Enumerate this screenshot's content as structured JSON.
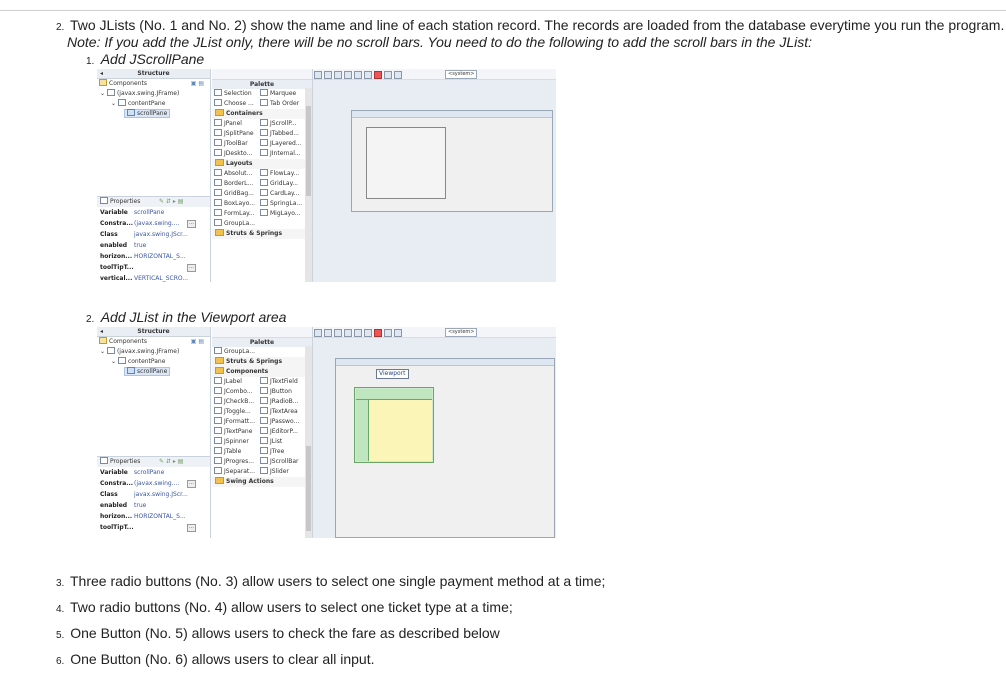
{
  "items": {
    "item2_num": "2.",
    "item2_text": "Two JLists (No. 1 and No. 2) show the name and line of each station record. The records are loaded from the database everytime you run the program.",
    "note": "Note: If you add the JList only, there will be no scroll bars. You need to do the following to add the scroll bars in the JList:",
    "sub1_num": "1.",
    "sub1_text": "Add JScrollPane",
    "sub2_num": "2.",
    "sub2_text": "Add JList in the Viewport area",
    "item3_num": "3.",
    "item3_text": "Three radio buttons (No. 3) allow users to select one single payment method at a time;",
    "item4_num": "4.",
    "item4_text": "Two radio buttons (No. 4) allow users to select one ticket type at a time;",
    "item5_num": "5.",
    "item5_text": "One Button (No. 5) allows users to check the fare as described below",
    "item6_num": "6.",
    "item6_text": "One Button (No. 6) allows users to clear all input."
  },
  "ide": {
    "structure": "Structure",
    "components": "Components",
    "frame": "(javax.swing.JFrame)",
    "content_pane": "contentPane",
    "scroll_pane": "scrollPane",
    "palette": "Palette",
    "system": "<system>",
    "viewport": "Viewport",
    "properties": "Properties",
    "props1": [
      {
        "k": "Variable",
        "v": "scrollPane"
      },
      {
        "k": "Constra...",
        "v": "(javax.swing...."
      },
      {
        "k": "Class",
        "v": "javax.swing.JScr..."
      },
      {
        "k": "enabled",
        "v": "true"
      },
      {
        "k": "horizon...",
        "v": "HORIZONTAL_S..."
      },
      {
        "k": "toolTipT...",
        "v": ""
      },
      {
        "k": "vertical...",
        "v": "VERTICAL_SCRO..."
      }
    ],
    "props2": [
      {
        "k": "Variable",
        "v": "scrollPane"
      },
      {
        "k": "Constra...",
        "v": "(javax.swing...."
      },
      {
        "k": "Class",
        "v": "javax.swing.JScr..."
      },
      {
        "k": "enabled",
        "v": "true"
      },
      {
        "k": "horizon...",
        "v": "HORIZONTAL_S..."
      },
      {
        "k": "toolTipT...",
        "v": ""
      }
    ],
    "palette1": [
      {
        "type": "row",
        "a": "Selection",
        "b": "Marquee"
      },
      {
        "type": "row",
        "a": "Choose ...",
        "b": "Tab Order"
      },
      {
        "type": "cat",
        "a": "Containers"
      },
      {
        "type": "row",
        "a": "JPanel",
        "b": "JScrollP..."
      },
      {
        "type": "row",
        "a": "JSplitPane",
        "b": "JTabbed..."
      },
      {
        "type": "row",
        "a": "JToolBar",
        "b": "JLayered..."
      },
      {
        "type": "row",
        "a": "JDeskto...",
        "b": "JInternal..."
      },
      {
        "type": "cat",
        "a": "Layouts"
      },
      {
        "type": "row",
        "a": "Absolut...",
        "b": "FlowLay..."
      },
      {
        "type": "row",
        "a": "BorderL...",
        "b": "GridLay..."
      },
      {
        "type": "row",
        "a": "GridBag...",
        "b": "CardLay..."
      },
      {
        "type": "row",
        "a": "BoxLayo...",
        "b": "SpringLa..."
      },
      {
        "type": "row",
        "a": "FormLay...",
        "b": "MigLayo..."
      },
      {
        "type": "row",
        "a": "GroupLa...",
        "b": ""
      },
      {
        "type": "cat",
        "a": "Struts & Springs"
      }
    ],
    "palette2": [
      {
        "type": "row",
        "a": "GroupLa...",
        "b": ""
      },
      {
        "type": "cat",
        "a": "Struts & Springs"
      },
      {
        "type": "cat",
        "a": "Components"
      },
      {
        "type": "row",
        "a": "JLabel",
        "b": "JTextField"
      },
      {
        "type": "row",
        "a": "JCombo...",
        "b": "JButton"
      },
      {
        "type": "row",
        "a": "JCheckB...",
        "b": "JRadioB..."
      },
      {
        "type": "row",
        "a": "JToggle...",
        "b": "JTextArea"
      },
      {
        "type": "row",
        "a": "JFormatt...",
        "b": "JPasswo..."
      },
      {
        "type": "row",
        "a": "JTextPane",
        "b": "JEditorP..."
      },
      {
        "type": "row",
        "a": "JSpinner",
        "b": "JList"
      },
      {
        "type": "row",
        "a": "JTable",
        "b": "JTree"
      },
      {
        "type": "row",
        "a": "JProgres...",
        "b": "JScrollBar"
      },
      {
        "type": "row",
        "a": "JSeparat...",
        "b": "JSlider"
      },
      {
        "type": "cat",
        "a": "Swing Actions"
      }
    ]
  }
}
